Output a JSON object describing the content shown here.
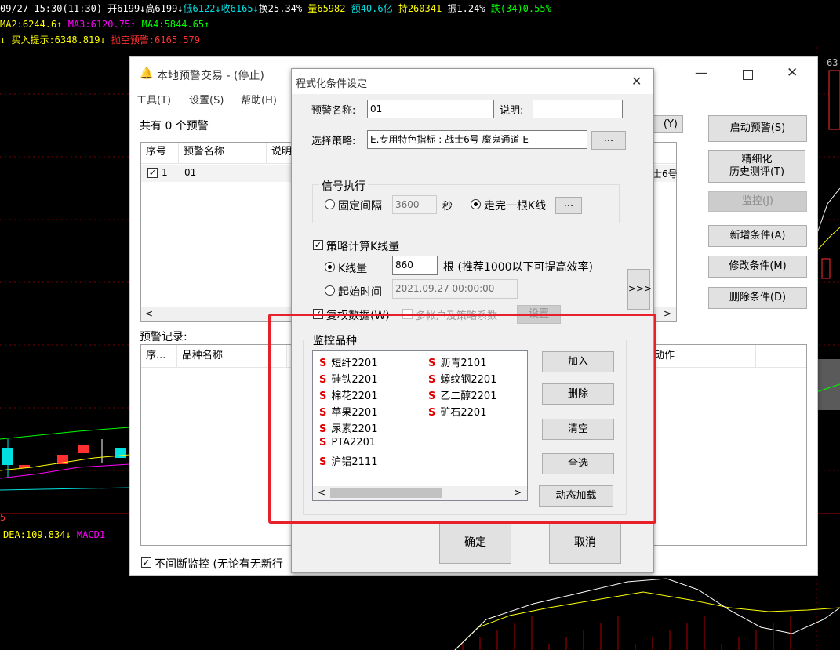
{
  "quote": {
    "line1": "09/27 15:30(11:30) 开6199↓高6199↓低6122↓收6165↓换25.34% 量65982 额40.6亿 持260341 振1.24% 跌(34)0.55%",
    "line1_parts": [
      {
        "text": "09/27 15:30(11:30) 开6199↓高6199↓",
        "color": "#ffffff"
      },
      {
        "text": "低6122↓收6165↓",
        "color": "#00e0e0"
      },
      {
        "text": "换25.34% ",
        "color": "#ffffff"
      },
      {
        "text": "量65982 ",
        "color": "#ffff00"
      },
      {
        "text": "额40.6亿 ",
        "color": "#00e0e0"
      },
      {
        "text": "持260341 ",
        "color": "#ffff00"
      },
      {
        "text": "振1.24% ",
        "color": "#ffffff"
      },
      {
        "text": "跌(34)0.55%",
        "color": "#00ff00"
      }
    ],
    "line2_parts": [
      {
        "text": "MA2:6244.6↑ ",
        "color": "#ffff00"
      },
      {
        "text": "MA3:6120.75↑ ",
        "color": "#ff00ff"
      },
      {
        "text": "MA4:5844.65↑",
        "color": "#00ff00"
      }
    ],
    "line3_parts": [
      {
        "text": "↓ 买入提示:6348.819↓ ",
        "color": "#ffff00"
      },
      {
        "text": "抛空预警:6165.579",
        "color": "#ff3030"
      }
    ],
    "bottom_label_parts": [
      {
        "text": "DEA:109.834↓ ",
        "color": "#ffff00"
      },
      {
        "text": "MACD1",
        "color": "#ff00ff"
      }
    ],
    "left_num": "5",
    "right_num": "63"
  },
  "bg_window": {
    "title": "本地预警交易 - (停止)",
    "menu": [
      "工具(T)",
      "设置(S)",
      "帮助(H)"
    ],
    "count_text": "共有 0 个预警",
    "table_headers": [
      "序号",
      "预警名称",
      "说明"
    ],
    "table_row": {
      "num": "1",
      "name": "01",
      "right": "士6号"
    },
    "partial_button": "(Y)",
    "buttons": {
      "start": "启动预警(S)",
      "refine_line1": "精细化",
      "refine_line2": "历史测评(T)",
      "monitor": "监控(J)",
      "add": "新增条件(A)",
      "modify": "修改条件(M)",
      "delete": "删除条件(D)"
    },
    "records_label": "预警记录:",
    "records_headers": [
      "序...",
      "品种名称"
    ],
    "records_right_header": "动作",
    "continuous_label": "不间断监控 (无论有无新行"
  },
  "dialog": {
    "title": "程式化条件设定",
    "name_label": "预警名称:",
    "name_value": "01",
    "desc_label": "说明:",
    "desc_value": "",
    "strategy_label": "选择策略:",
    "strategy_value": "E.专用特色指标 : 战士6号  魔鬼通道 E",
    "ellipsis": "...",
    "signal_group": "信号执行",
    "fixed_interval_label": "固定间隔",
    "fixed_interval_value": "3600",
    "seconds_label": "秒",
    "kline_finish_label": "走完一根K线",
    "calc_kline_label": "策略计算K线量",
    "kline_count_label": "K线量",
    "kline_count_value": "860",
    "kline_note": "根 (推荐1000以下可提高效率)",
    "start_time_label": "起始时间",
    "start_time_value": "2021.09.27 00:00:00",
    "expand_button": ">>>",
    "restore_label": "复权数据(W)",
    "multi_account_label": "多帐户及策略系数",
    "settings_button": "设置",
    "monitor_group": "监控品种",
    "symbols_col1": [
      "短纤2201",
      "硅铁2201",
      "棉花2201",
      "苹果2201",
      "尿素2201",
      "PTA2201",
      "沪铝2111"
    ],
    "symbols_col2": [
      "沥青2101",
      "螺纹钢2201",
      "乙二醇2201",
      "矿石2201"
    ],
    "symbol_prefix": "S",
    "buttons": {
      "add": "加入",
      "delete": "删除",
      "clear": "清空",
      "select_all": "全选",
      "dynamic_load": "动态加载",
      "ok": "确定",
      "cancel": "取消"
    }
  }
}
